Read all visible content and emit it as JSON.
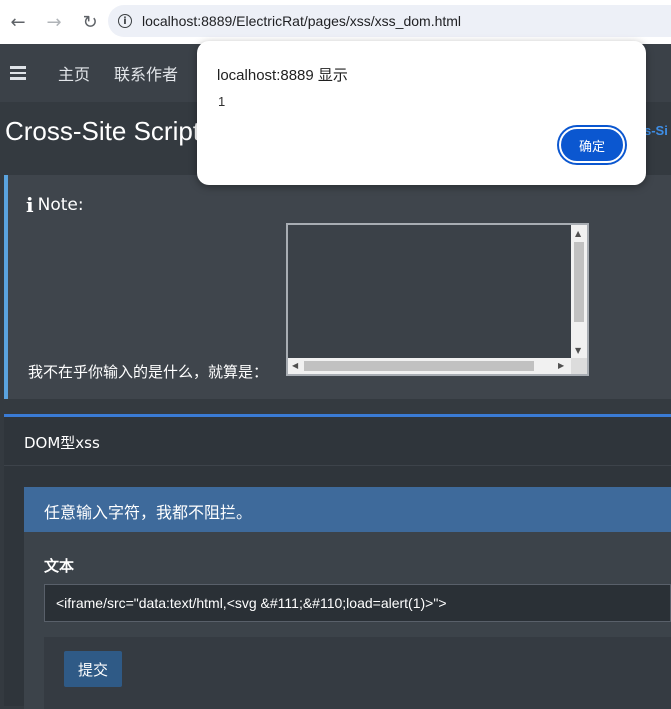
{
  "browser": {
    "url": "localhost:8889/ElectricRat/pages/xss/xss_dom.html",
    "back_icon": "arrow-left-icon",
    "forward_icon": "arrow-right-icon",
    "reload_icon": "reload-icon",
    "back_glyph": "←",
    "forward_glyph": "→",
    "reload_glyph": "↻"
  },
  "nav": {
    "items": [
      "主页",
      "联系作者"
    ]
  },
  "page": {
    "title": "Cross-Site Script",
    "title_link": "s-Si"
  },
  "note": {
    "heading": "Note:",
    "text": "我不在乎你输入的是什么，就算是："
  },
  "dom_card": {
    "title": "DOM型xss",
    "panel_heading": "任意输入字符，我都不阻拦。",
    "field_label": "文本",
    "input_value": "<iframe/src=\"data:text/html,<svg &#111;&#110;load=alert(1)>\">",
    "submit_label": "提交"
  },
  "alert": {
    "title": "localhost:8889 显示",
    "message": "1",
    "ok_label": "确定"
  },
  "colors": {
    "accent": "#3a7bd5",
    "note_border": "#5aa3df",
    "dialog_button": "#0b57d0"
  }
}
